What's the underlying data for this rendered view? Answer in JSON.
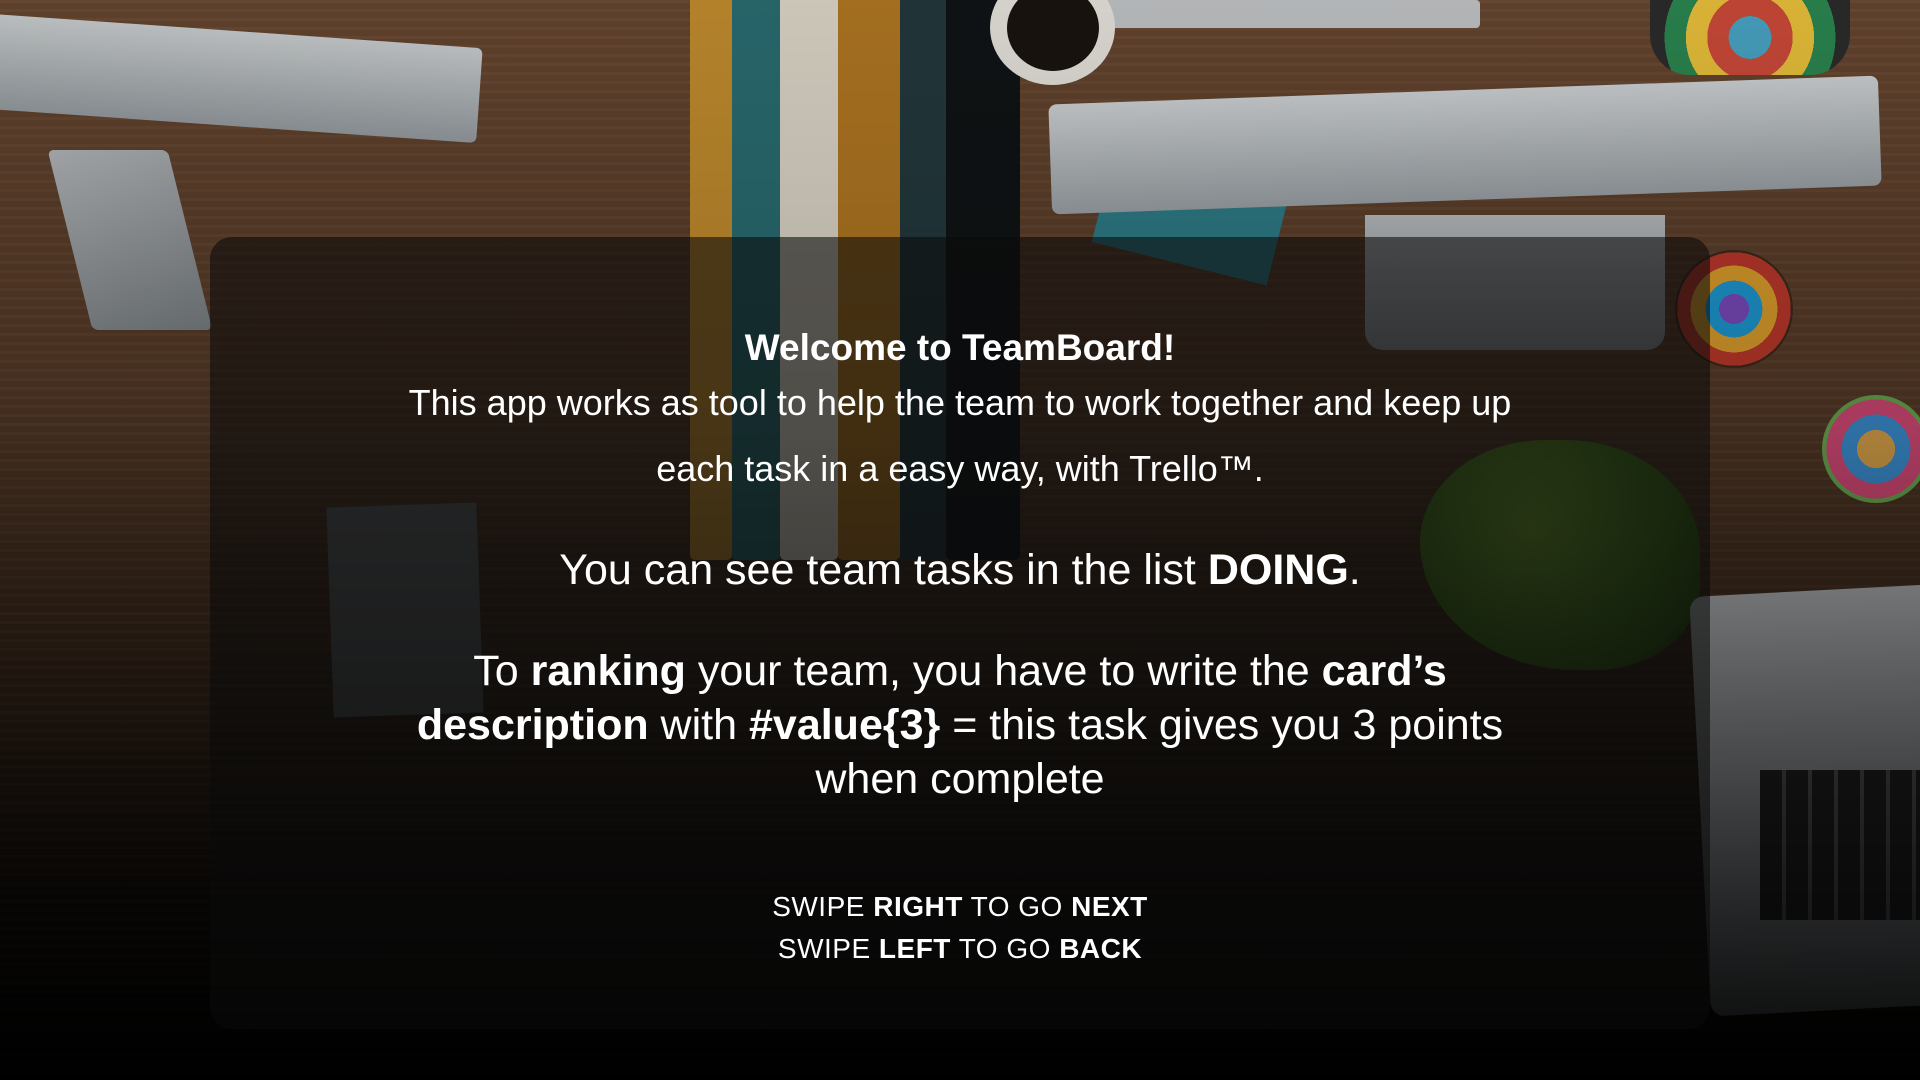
{
  "welcome": {
    "title": "Welcome to TeamBoard!",
    "intro_line1": "This app works as tool to help the team to work together and keep up",
    "intro_line2": "each task in a easy way, with Trello™."
  },
  "doing": {
    "prefix": "You can see team tasks in the list ",
    "list_name": "DOING",
    "suffix": "."
  },
  "ranking": {
    "t1": "To ",
    "b1": "ranking",
    "t2": " your team, you have to write the ",
    "b2": "card’s description",
    "t3": " with ",
    "b3": "#value{3}",
    "t4": " = this task gives you 3 points when complete"
  },
  "swipe": {
    "right_prefix": "SWIPE ",
    "right_dir": "RIGHT",
    "right_mid": " TO GO ",
    "right_action": "NEXT",
    "left_prefix": "SWIPE ",
    "left_dir": "LEFT",
    "left_mid": " TO GO ",
    "left_action": "BACK"
  },
  "colors": {
    "text": "#ffffff",
    "panel": "rgba(10,10,10,0.58)"
  }
}
